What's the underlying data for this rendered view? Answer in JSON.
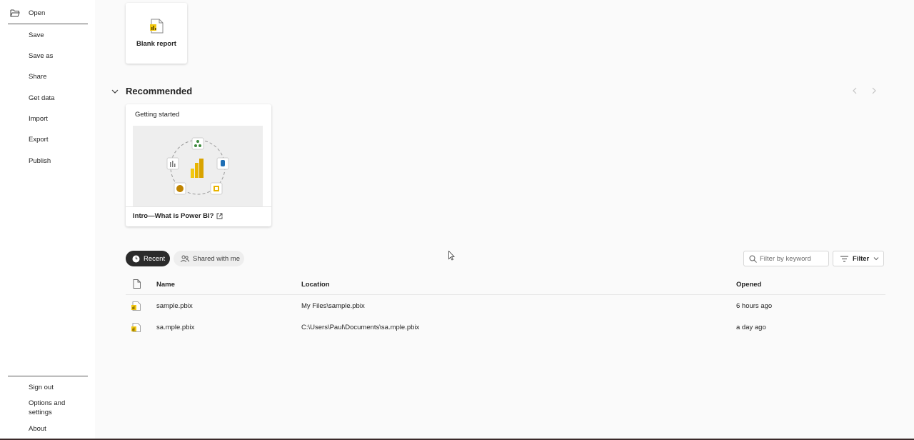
{
  "sidebar": {
    "top_items": [
      {
        "label": "Open",
        "icon": "folder-open-icon"
      },
      {
        "label": "Save"
      },
      {
        "label": "Save as"
      },
      {
        "label": "Share"
      },
      {
        "label": "Get data"
      },
      {
        "label": "Import"
      },
      {
        "label": "Export"
      },
      {
        "label": "Publish"
      }
    ],
    "bottom_items": [
      {
        "label": "Sign out"
      },
      {
        "label": "Options and settings"
      },
      {
        "label": "About"
      }
    ]
  },
  "new_section": {
    "blank_report_label": "Blank report"
  },
  "recommended": {
    "title": "Recommended",
    "card": {
      "header": "Getting started",
      "link_text": "Intro—What is Power BI?"
    }
  },
  "tabs": [
    {
      "label": "Recent",
      "icon": "clock-icon",
      "active": true
    },
    {
      "label": "Shared with me",
      "icon": "people-icon",
      "active": false
    }
  ],
  "filter": {
    "placeholder": "Filter by keyword",
    "button_label": "Filter"
  },
  "table": {
    "columns": [
      "Name",
      "Location",
      "Opened"
    ],
    "rows": [
      {
        "name": "sample.pbix",
        "location": "My Files\\sample.pbix",
        "opened": "6 hours ago"
      },
      {
        "name": "sa.mple.pbix",
        "location": "C:\\Users\\Paul\\Documents\\sa.mple.pbix",
        "opened": "a day ago"
      }
    ]
  },
  "colors": {
    "accent_dark": "#2b2b2b",
    "powerbi_yellow": "#f2c811"
  }
}
